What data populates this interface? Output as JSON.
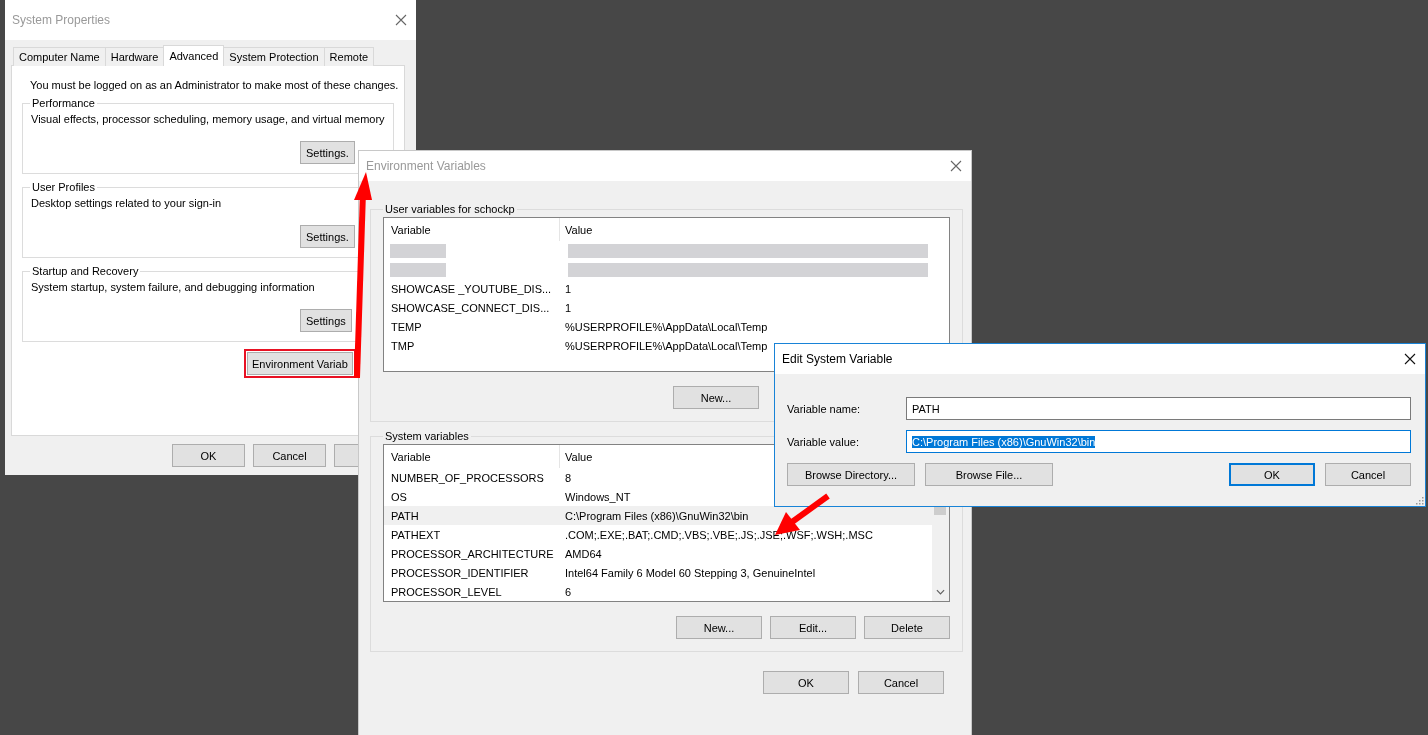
{
  "system_properties": {
    "title": "System Properties",
    "active": false,
    "tabs": [
      {
        "label": "Computer Name",
        "selected": false
      },
      {
        "label": "Hardware",
        "selected": false
      },
      {
        "label": "Advanced",
        "selected": true
      },
      {
        "label": "System Protection",
        "selected": false
      },
      {
        "label": "Remote",
        "selected": false
      }
    ],
    "notice": "You must be logged on as an Administrator to make most of these changes.",
    "groups": [
      {
        "title": "Performance",
        "description": "Visual effects, processor scheduling, memory usage, and virtual memory",
        "button": "Settings."
      },
      {
        "title": "User Profiles",
        "description": "Desktop settings related to your sign-in",
        "button": "Settings."
      },
      {
        "title": "Startup and Recovery",
        "description": "System startup, system failure, and debugging information",
        "button": "Settings"
      }
    ],
    "environment_button": "Environment Variab",
    "buttons": [
      "OK",
      "Cancel"
    ]
  },
  "environment_variables": {
    "title": "Environment Variables",
    "active": false,
    "user_group": {
      "title": "User variables for schockp",
      "columns": [
        "Variable",
        "Value"
      ],
      "rows": [
        {
          "kind": "redacted",
          "selected": false
        },
        {
          "kind": "redacted",
          "selected": false
        },
        {
          "kind": "text",
          "variable": "SHOWCASE _YOUTUBE_DIS...",
          "value": "1",
          "selected": false
        },
        {
          "kind": "text",
          "variable": "SHOWCASE_CONNECT_DIS...",
          "value": "1",
          "selected": false
        },
        {
          "kind": "text",
          "variable": "TEMP",
          "value": "%USERPROFILE%\\AppData\\Local\\Temp",
          "selected": false
        },
        {
          "kind": "text",
          "variable": "TMP",
          "value": "%USERPROFILE%\\AppData\\Local\\Temp",
          "selected": false
        }
      ],
      "buttons": [
        "New..."
      ]
    },
    "system_group": {
      "title": "System variables",
      "columns": [
        "Variable",
        "Value"
      ],
      "rows": [
        {
          "kind": "text",
          "variable": "NUMBER_OF_PROCESSORS",
          "value": "8",
          "selected": false
        },
        {
          "kind": "text",
          "variable": "OS",
          "value": "Windows_NT",
          "selected": false
        },
        {
          "kind": "text",
          "variable": "PATH",
          "value": "C:\\Program Files (x86)\\GnuWin32\\bin",
          "selected": true
        },
        {
          "kind": "text",
          "variable": "PATHEXT",
          "value": ".COM;.EXE;.BAT;.CMD;.VBS;.VBE;.JS;.JSE;.WSF;.WSH;.MSC",
          "selected": false
        },
        {
          "kind": "text",
          "variable": "PROCESSOR_ARCHITECTURE",
          "value": "AMD64",
          "selected": false
        },
        {
          "kind": "text",
          "variable": "PROCESSOR_IDENTIFIER",
          "value": "Intel64 Family 6 Model 60 Stepping 3, GenuineIntel",
          "selected": false
        },
        {
          "kind": "text",
          "variable": "PROCESSOR_LEVEL",
          "value": "6",
          "selected": false
        }
      ],
      "buttons": [
        "New...",
        "Edit...",
        "Delete"
      ]
    },
    "buttons": [
      "OK",
      "Cancel"
    ]
  },
  "edit_dialog": {
    "title": "Edit System Variable",
    "active": true,
    "fields": [
      {
        "label": "Variable name:",
        "value": "PATH",
        "selected": false
      },
      {
        "label": "Variable value:",
        "value": "C:\\Program Files (x86)\\GnuWin32\\bin",
        "selected": true
      }
    ],
    "left_buttons": [
      {
        "label": "Browse Directory...",
        "default": false
      },
      {
        "label": "Browse File...",
        "default": false
      }
    ],
    "right_buttons": [
      {
        "label": "OK",
        "default": true
      },
      {
        "label": "Cancel",
        "default": false
      }
    ]
  }
}
